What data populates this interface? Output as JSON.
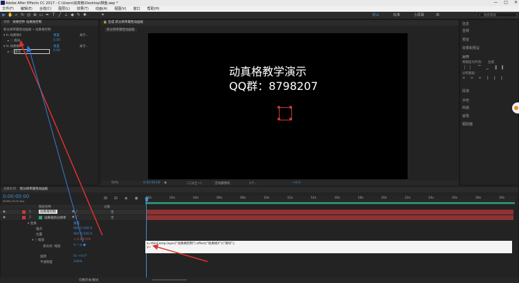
{
  "app": {
    "title": "Adobe After Effects CC 2017 - C:\\Users\\动真格\\Desktop\\棋盘.aep *",
    "window_controls": [
      "—",
      "□",
      "✕"
    ]
  },
  "menu": [
    "文件(F)",
    "编辑(E)",
    "合成(C)",
    "图层(L)",
    "效果(T)",
    "动画(A)",
    "视图(V)",
    "窗口",
    "帮助(H)"
  ],
  "toolbar": {
    "workspaces": [
      "默认",
      "标准",
      "小屏幕",
      "库"
    ],
    "active_workspace": "默认",
    "search_placeholder": "搜索帮助"
  },
  "effects_panel": {
    "tabs": [
      "项目",
      "效果控件 动真格控制"
    ],
    "breadcrumb": "新分辨率属性动画板 • 动真格控制",
    "rows": [
      {
        "name": "动真格X",
        "value": "重置",
        "extra": "关于..."
      },
      {
        "name": "滑块",
        "value": "0.00",
        "extra": ""
      },
      {
        "name": "动真格Y",
        "value": "重置",
        "extra": "关于..."
      },
      {
        "name": "滑块",
        "value": "0.00",
        "extra": ""
      }
    ]
  },
  "composition_panel": {
    "tab": "合成 新分辨率属性动画板",
    "subtab": "新分辨率属性动画板",
    "overlay_line1": "动真格教学演示",
    "overlay_line2": "QQ群：8798207",
    "footer": {
      "zoom": "50%",
      "timecode": "0:00:00:00",
      "resolution": "(二分之一)",
      "camera": "活动摄像机",
      "views": "1个...",
      "exposure": "+0.0"
    }
  },
  "right_panel": {
    "items": [
      "信息",
      "音频",
      "预览",
      "效果和预设",
      "对齐",
      "段落",
      "字符",
      "绘画",
      "画笔",
      "跟踪器"
    ],
    "align_label": "将图层对齐到：",
    "align_target": "合成",
    "distribute_label": "分布图层："
  },
  "timeline": {
    "tabs": [
      "渲染队列",
      "新分辨率属性动画板"
    ],
    "timecode": "0:00:00:00",
    "fps": "00000 (25.00 fps)",
    "columns": {
      "source": "图层名称",
      "parent": "父级"
    },
    "layers": [
      {
        "num": "1",
        "name": "动真格控制",
        "parent": "无",
        "color": "#c83a3a"
      },
      {
        "num": "2",
        "name": "动真格新分辨率",
        "parent": "无",
        "color": "#c83a3a"
      }
    ],
    "properties": [
      {
        "name": "变换",
        "value": "重置"
      },
      {
        "name": "锚点",
        "value": "960.0,540.0"
      },
      {
        "name": "位置",
        "value": "960.0,540.0"
      },
      {
        "name": "缩放",
        "value": "∞ 0.0,0.0%"
      },
      {
        "name": "表达式: 缩放",
        "value": ""
      },
      {
        "name": "旋转",
        "value": "0x +0.0°"
      },
      {
        "name": "不透明度",
        "value": "100%"
      }
    ],
    "ruler": [
      "00s",
      "02s",
      "04s",
      "06s",
      "08s",
      "10s",
      "12s",
      "14s",
      "16s",
      "18s",
      "20s",
      "22s",
      "24s",
      "26s",
      "28s",
      "30s"
    ],
    "expression_line1": "x=thisComp.layer(\"动真格控制\").effect(\"动真格X\")(\"滑块\");",
    "expression_line2": "y=",
    "bottom_label": "切换开关/模式"
  }
}
